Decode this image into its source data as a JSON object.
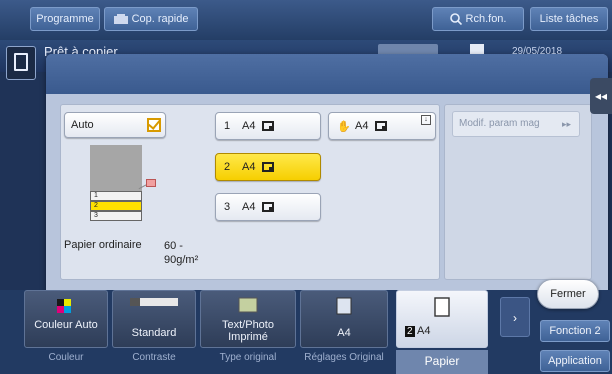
{
  "topbar": {
    "programme": "Programme",
    "cop_rapide": "Cop. rapide",
    "search": "Rch.fon.",
    "liste_taches": "Liste tâches"
  },
  "status": {
    "title": "Prêt à copier",
    "date": "29/05/2018"
  },
  "paper_dialog": {
    "auto_label": "Auto",
    "auto_checked": true,
    "trays": [
      {
        "num": "1",
        "size": "A4"
      },
      {
        "num": "2",
        "size": "A4",
        "selected": true
      },
      {
        "num": "3",
        "size": "A4"
      }
    ],
    "bypass": {
      "size": "A4"
    },
    "modif_param_mag": "Modif. param mag",
    "paper_type": "Papier ordinaire",
    "paper_weight": "60 - 90g/m²",
    "illus_rows": [
      "1",
      "2",
      "3"
    ],
    "close": "Fermer"
  },
  "bottombar": {
    "functions": [
      {
        "label": "Couleur Auto",
        "caption": "Couleur"
      },
      {
        "label": "Standard",
        "caption": "Contraste"
      },
      {
        "label": "Text/Photo Imprimé",
        "caption": "Type original"
      },
      {
        "label": "A4",
        "caption": "Réglages Original"
      },
      {
        "label": "A4",
        "tray": "2",
        "caption": "Papier"
      }
    ],
    "fonction2": "Fonction 2",
    "application": "Application"
  },
  "colors": {
    "selected": "#ffe100",
    "checkbox": "#d89a00"
  }
}
